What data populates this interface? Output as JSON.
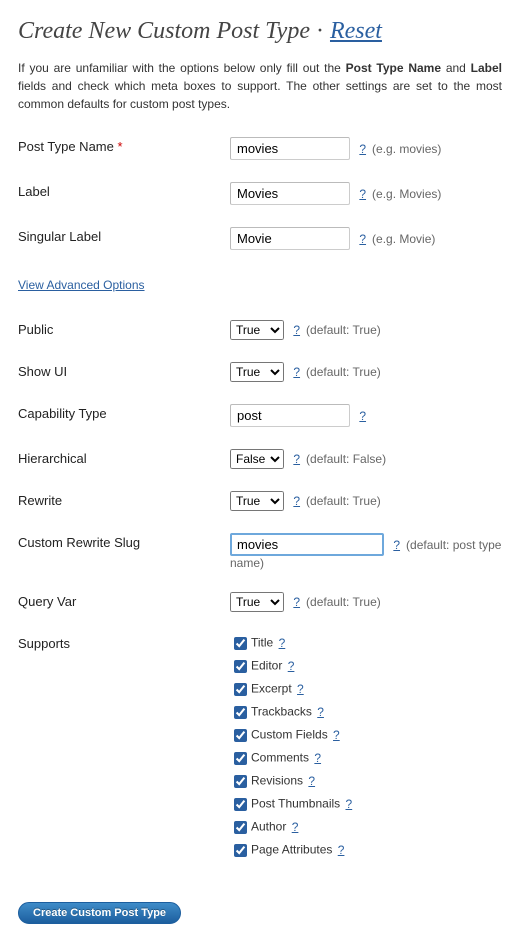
{
  "header": {
    "title": "Create New Custom Post Type",
    "separator": " · ",
    "reset_label": "Reset"
  },
  "intro": {
    "prefix": "If you are unfamiliar with the options below only fill out the ",
    "bold1": "Post Type Name",
    "mid": " and ",
    "bold2": "Label",
    "suffix": " fields and check which meta boxes to support. The other settings are set to the most common defaults for custom post types."
  },
  "help_symbol": "?",
  "fields": {
    "post_type_name": {
      "label": "Post Type Name",
      "required_mark": "*",
      "value": "movies",
      "hint": "(e.g. movies)"
    },
    "label": {
      "label": "Label",
      "value": "Movies",
      "hint": "(e.g. Movies)"
    },
    "singular_label": {
      "label": "Singular Label",
      "value": "Movie",
      "hint": "(e.g. Movie)"
    },
    "advanced_link": "View Advanced Options",
    "public": {
      "label": "Public",
      "value": "True",
      "hint": "(default: True)"
    },
    "show_ui": {
      "label": "Show UI",
      "value": "True",
      "hint": "(default: True)"
    },
    "capability_type": {
      "label": "Capability Type",
      "value": "post"
    },
    "hierarchical": {
      "label": "Hierarchical",
      "value": "False",
      "hint": "(default: False)"
    },
    "rewrite": {
      "label": "Rewrite",
      "value": "True",
      "hint": "(default: True)"
    },
    "custom_rewrite_slug": {
      "label": "Custom Rewrite Slug",
      "value": "movies",
      "hint": "(default: post type name)"
    },
    "query_var": {
      "label": "Query Var",
      "value": "True",
      "hint": "(default: True)"
    }
  },
  "select_options": {
    "boolean": [
      "True",
      "False"
    ]
  },
  "supports": {
    "label": "Supports",
    "items": [
      {
        "label": "Title",
        "checked": true
      },
      {
        "label": "Editor",
        "checked": true
      },
      {
        "label": "Excerpt",
        "checked": true
      },
      {
        "label": "Trackbacks",
        "checked": true
      },
      {
        "label": "Custom Fields",
        "checked": true
      },
      {
        "label": "Comments",
        "checked": true
      },
      {
        "label": "Revisions",
        "checked": true
      },
      {
        "label": "Post Thumbnails",
        "checked": true
      },
      {
        "label": "Author",
        "checked": true
      },
      {
        "label": "Page Attributes",
        "checked": true
      }
    ]
  },
  "submit_label": "Create Custom Post Type"
}
